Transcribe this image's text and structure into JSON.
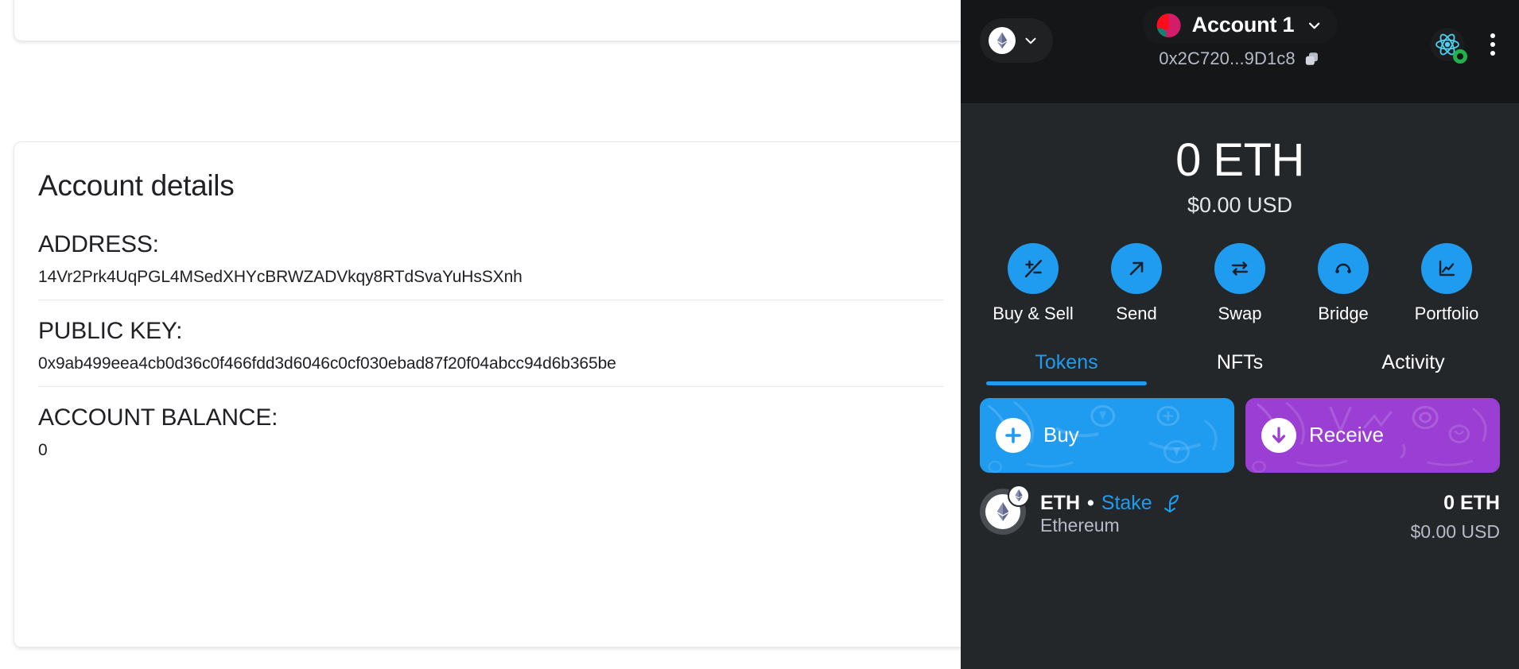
{
  "dapp": {
    "title": "Account details",
    "fields": [
      {
        "label": "ADDRESS:",
        "value": "14Vr2Prk4UqPGL4MSedXHYcBRWZADVkqy8RTdSvaYuHsSXnh"
      },
      {
        "label": "PUBLIC KEY:",
        "value": "0x9ab499eea4cb0d36c0f466fdd3d6046c0cf030ebad87f20f04abcc94d6b365be"
      },
      {
        "label": "ACCOUNT BALANCE:",
        "value": "0"
      }
    ]
  },
  "wallet": {
    "network": {
      "name": "Ethereum Mainnet",
      "icon": "ethereum-icon",
      "chevron": "chevron-down-icon"
    },
    "account": {
      "name": "Account 1",
      "address": "0x2C720...9D1c8",
      "avatar_colors": [
        "#fc0d1b",
        "#d41c6b",
        "#1a7f70"
      ],
      "copy_icon": "copy-icon",
      "chevron": "chevron-down-icon"
    },
    "header_right": {
      "connection_icon": "react-logo-icon",
      "connection_status_color": "#21b24b",
      "menu_icon": "kebab-menu-icon"
    },
    "balance": {
      "primary": "0 ETH",
      "secondary": "$0.00 USD"
    },
    "actions": [
      {
        "label": "Buy & Sell",
        "icon": "plus-minus-icon"
      },
      {
        "label": "Send",
        "icon": "arrow-up-right-icon"
      },
      {
        "label": "Swap",
        "icon": "swap-arrows-icon"
      },
      {
        "label": "Bridge",
        "icon": "bridge-arc-icon"
      },
      {
        "label": "Portfolio",
        "icon": "chart-line-icon"
      }
    ],
    "tabs": [
      {
        "label": "Tokens",
        "active": true
      },
      {
        "label": "NFTs",
        "active": false
      },
      {
        "label": "Activity",
        "active": false
      }
    ],
    "promos": [
      {
        "label": "Buy",
        "icon": "plus-circle-icon",
        "color": "#1f9cf0"
      },
      {
        "label": "Receive",
        "icon": "arrow-down-circle-icon",
        "color": "#9b3fd4"
      }
    ],
    "tokens": [
      {
        "symbol": "ETH",
        "separator": "•",
        "stake_label": "Stake",
        "stake_icon": "sprout-icon",
        "name": "Ethereum",
        "amount": "0 ETH",
        "fiat": "$0.00 USD",
        "icon": "ethereum-token-icon",
        "badge_icon": "ethereum-network-badge-icon"
      }
    ],
    "colors": {
      "panel_bg": "#24272a",
      "header_bg": "#141618",
      "accent": "#1f9cf0",
      "purple": "#9b3fd4",
      "muted_text": "#b7bbc8"
    }
  }
}
